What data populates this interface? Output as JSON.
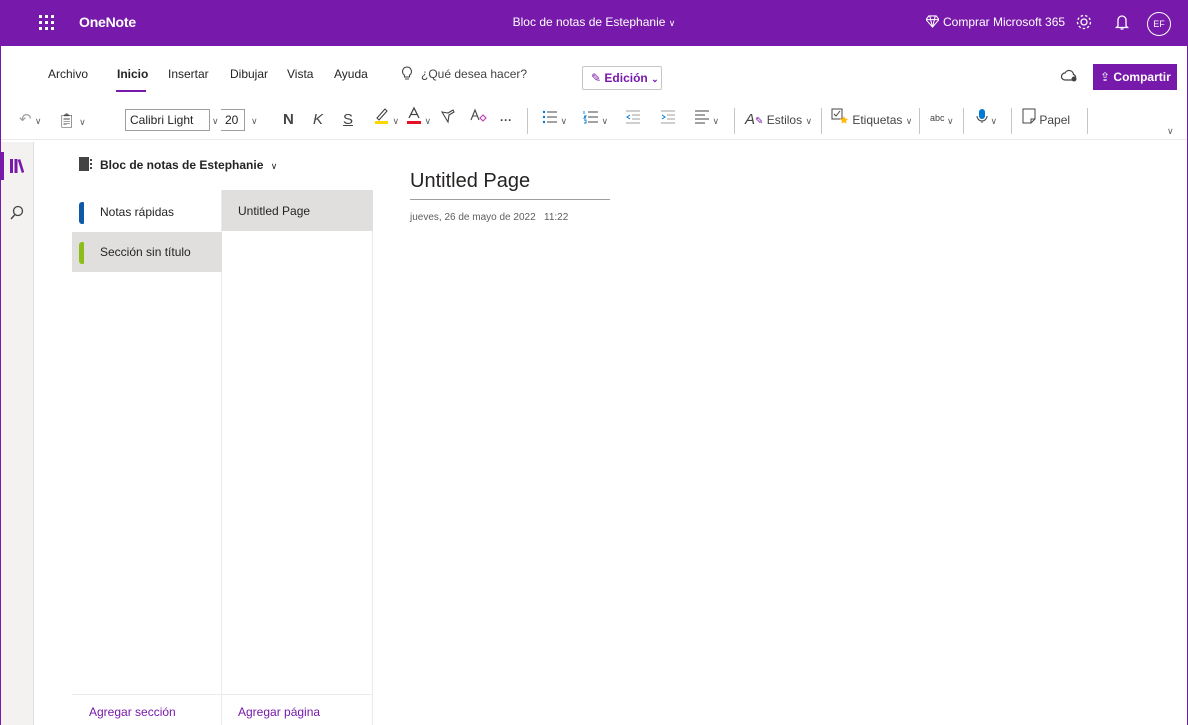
{
  "app": {
    "name": "OneNote",
    "notebook_title": "Bloc de notas de Estephanie",
    "buy_label": "Comprar Microsoft 365",
    "avatar_initials": "EF",
    "accent_color": "#7719aa"
  },
  "menu": {
    "items": [
      "Archivo",
      "Inicio",
      "Insertar",
      "Dibujar",
      "Vista",
      "Ayuda"
    ],
    "active": "Inicio",
    "tell_me_placeholder": "¿Qué desea hacer?",
    "edit_mode_label": "Edición",
    "share_label": "Compartir"
  },
  "ribbon": {
    "font_name": "Calibri Light",
    "font_size": "20",
    "bold": "N",
    "italic": "K",
    "underline": "S",
    "more": "···",
    "styles_label": "Estilos",
    "tags_label": "Etiquetas",
    "paper_label": "Papel",
    "spell_label": "abc"
  },
  "navigation": {
    "notebook_name": "Bloc de notas de Estephanie",
    "sections": [
      {
        "label": "Notas rápidas",
        "color": "#0e5aa6"
      },
      {
        "label": "Sección sin título",
        "color": "#8cbd18"
      }
    ],
    "pages": [
      "Untitled Page"
    ],
    "add_section": "Agregar sección",
    "add_page": "Agregar página"
  },
  "page": {
    "title": "Untitled Page",
    "date": "jueves, 26 de mayo de 2022",
    "time": "11:22"
  }
}
